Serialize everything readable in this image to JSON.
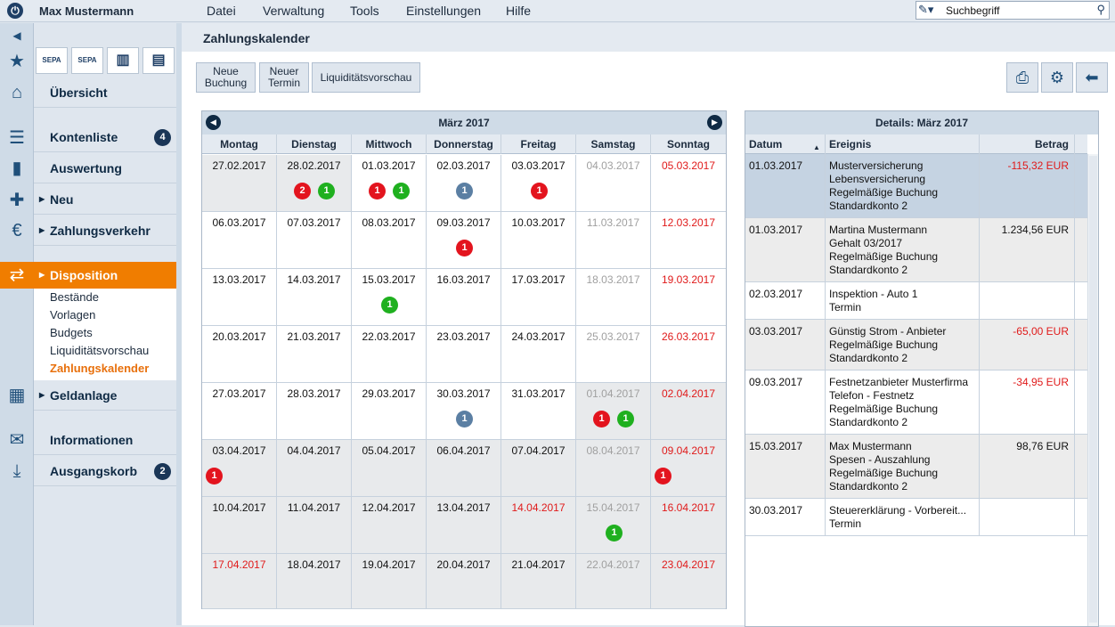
{
  "topbar": {
    "user": "Max Mustermann",
    "menu": [
      "Datei",
      "Verwaltung",
      "Tools",
      "Einstellungen",
      "Hilfe"
    ],
    "search_placeholder": "Suchbegriff"
  },
  "sidebar": {
    "nav": [
      {
        "label": "Übersicht"
      },
      {
        "label": "Kontenliste",
        "badge": "4"
      },
      {
        "label": "Auswertung"
      },
      {
        "label": "Neu"
      },
      {
        "label": "Zahlungsverkehr"
      },
      {
        "label": "Disposition"
      },
      {
        "label": "Geldanlage"
      },
      {
        "label": "Informationen"
      },
      {
        "label": "Ausgangskorb",
        "badge": "2"
      }
    ],
    "sub": [
      "Bestände",
      "Vorlagen",
      "Budgets",
      "Liquiditätsvorschau",
      "Zahlungskalender"
    ],
    "sepa_label": "SEPA"
  },
  "page": {
    "title": "Zahlungskalender",
    "buttons": [
      {
        "line1": "Neue",
        "line2": "Buchung"
      },
      {
        "line1": "Neuer",
        "line2": "Termin"
      },
      {
        "line1": "Liquiditätsvorschau",
        "line2": ""
      }
    ]
  },
  "calendar": {
    "month": "März 2017",
    "days": [
      "Montag",
      "Dienstag",
      "Mittwoch",
      "Donnerstag",
      "Freitag",
      "Samstag",
      "Sonntag"
    ],
    "weeks": [
      [
        "27.02.2017",
        "28.02.2017",
        "01.03.2017",
        "02.03.2017",
        "03.03.2017",
        "04.03.2017",
        "05.03.2017"
      ],
      [
        "06.03.2017",
        "07.03.2017",
        "08.03.2017",
        "09.03.2017",
        "10.03.2017",
        "11.03.2017",
        "12.03.2017"
      ],
      [
        "13.03.2017",
        "14.03.2017",
        "15.03.2017",
        "16.03.2017",
        "17.03.2017",
        "18.03.2017",
        "19.03.2017"
      ],
      [
        "20.03.2017",
        "21.03.2017",
        "22.03.2017",
        "23.03.2017",
        "24.03.2017",
        "25.03.2017",
        "26.03.2017"
      ],
      [
        "27.03.2017",
        "28.03.2017",
        "29.03.2017",
        "30.03.2017",
        "31.03.2017",
        "01.04.2017",
        "02.04.2017"
      ],
      [
        "03.04.2017",
        "04.04.2017",
        "05.04.2017",
        "06.04.2017",
        "07.04.2017",
        "08.04.2017",
        "09.04.2017"
      ],
      [
        "10.04.2017",
        "11.04.2017",
        "12.04.2017",
        "13.04.2017",
        "14.04.2017",
        "15.04.2017",
        "16.04.2017"
      ],
      [
        "17.04.2017",
        "18.04.2017",
        "19.04.2017",
        "20.04.2017",
        "21.04.2017",
        "22.04.2017",
        "23.04.2017"
      ]
    ],
    "events": [
      {
        "week": 0,
        "day": 1,
        "items": [
          {
            "n": "2",
            "c": "red"
          },
          {
            "n": "1",
            "c": "green"
          }
        ]
      },
      {
        "week": 0,
        "day": 2,
        "items": [
          {
            "n": "1",
            "c": "red"
          },
          {
            "n": "1",
            "c": "green"
          }
        ]
      },
      {
        "week": 0,
        "day": 3,
        "items": [
          {
            "n": "1",
            "c": "blue"
          }
        ]
      },
      {
        "week": 0,
        "day": 4,
        "items": [
          {
            "n": "1",
            "c": "red"
          }
        ]
      },
      {
        "week": 1,
        "day": 3,
        "items": [
          {
            "n": "1",
            "c": "red"
          }
        ]
      },
      {
        "week": 2,
        "day": 2,
        "items": [
          {
            "n": "1",
            "c": "green"
          }
        ]
      },
      {
        "week": 4,
        "day": 3,
        "items": [
          {
            "n": "1",
            "c": "blue"
          }
        ]
      },
      {
        "week": 4,
        "day": 5,
        "items": [
          {
            "n": "1",
            "c": "red"
          },
          {
            "n": "1",
            "c": "green"
          }
        ]
      },
      {
        "week": 5,
        "day": 0,
        "items": [
          {
            "n": "1",
            "c": "red"
          }
        ]
      },
      {
        "week": 5,
        "day": 6,
        "items": [
          {
            "n": "1",
            "c": "red"
          }
        ]
      },
      {
        "week": 6,
        "day": 5,
        "items": [
          {
            "n": "1",
            "c": "green"
          }
        ]
      }
    ],
    "colors": {
      "red": "#e3141e",
      "green": "#1fb01f",
      "blue": "#5b7fa3",
      "grey_bg": "#e8eaec",
      "selected_bg": "#e8eaec"
    }
  },
  "details": {
    "title": "Details: März 2017",
    "columns": [
      "Datum",
      "Ereignis",
      "Betrag"
    ],
    "rows": [
      {
        "date": "01.03.2017",
        "lines": [
          "Musterversicherung",
          "Lebensversicherung",
          "Regelmäßige Buchung",
          "Standardkonto 2"
        ],
        "amount": "-115,32 EUR",
        "neg": true,
        "bg": "#c5d3e2"
      },
      {
        "date": "01.03.2017",
        "lines": [
          "Martina Mustermann",
          "Gehalt 03/2017",
          "Regelmäßige Buchung",
          "Standardkonto 2"
        ],
        "amount": "1.234,56 EUR",
        "neg": false,
        "bg": "#ececec"
      },
      {
        "date": "02.03.2017",
        "lines": [
          "Inspektion - Auto 1",
          "Termin"
        ],
        "amount": "",
        "neg": false,
        "bg": "#ffffff"
      },
      {
        "date": "03.03.2017",
        "lines": [
          "Günstig Strom - Anbieter",
          "Regelmäßige Buchung",
          "Standardkonto 2"
        ],
        "amount": "-65,00 EUR",
        "neg": true,
        "bg": "#ececec"
      },
      {
        "date": "09.03.2017",
        "lines": [
          "Festnetzanbieter Musterfirma",
          "Telefon - Festnetz",
          "Regelmäßige Buchung",
          "Standardkonto 2"
        ],
        "amount": "-34,95 EUR",
        "neg": true,
        "bg": "#ffffff"
      },
      {
        "date": "15.03.2017",
        "lines": [
          "Max Mustermann",
          "Spesen - Auszahlung",
          "Regelmäßige Buchung",
          "Standardkonto 2"
        ],
        "amount": "98,76 EUR",
        "neg": false,
        "bg": "#ececec"
      },
      {
        "date": "30.03.2017",
        "lines": [
          "Steuererklärung - Vorbereit...",
          "Termin"
        ],
        "amount": "",
        "neg": false,
        "bg": "#ffffff"
      }
    ]
  },
  "icons": {
    "power": "power-icon",
    "back": "back-icon",
    "star": "star-icon",
    "home": "home-icon",
    "print": "print-icon",
    "settings": "gear-icon",
    "return": "arrow-left-icon"
  }
}
